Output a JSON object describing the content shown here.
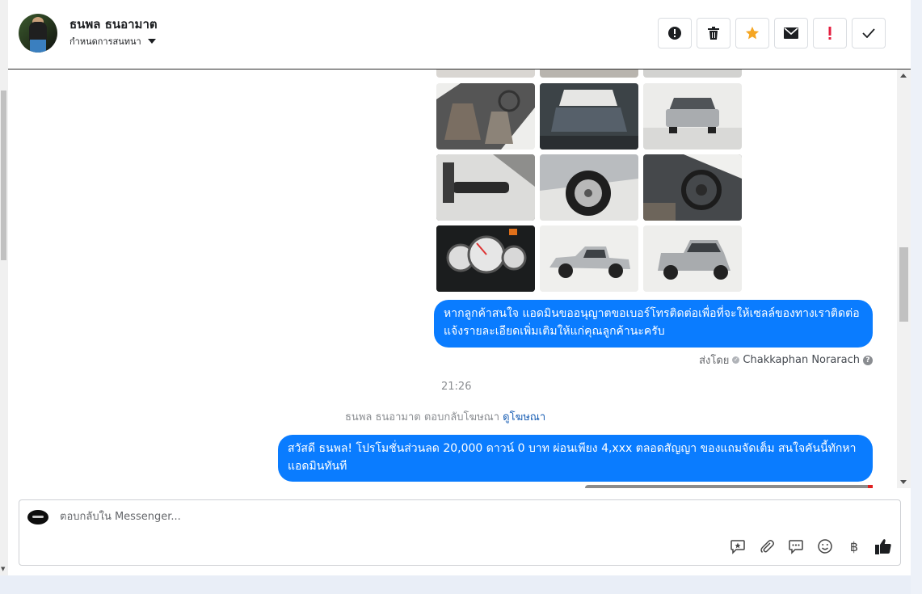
{
  "header": {
    "contact_name": "ธนพล ธนอามาต",
    "status_label": "กำหนดการสนทนา",
    "actions": [
      {
        "name": "alert-icon",
        "color": "#1c1e21"
      },
      {
        "name": "trash-icon",
        "color": "#1c1e21"
      },
      {
        "name": "star-icon",
        "color": "#f5a623"
      },
      {
        "name": "mail-icon",
        "color": "#1c1e21"
      },
      {
        "name": "exclamation-icon",
        "color": "#e41e3f"
      },
      {
        "name": "check-icon",
        "color": "#1c1e21"
      }
    ]
  },
  "conversation": {
    "photos": [
      "car-interior-front-seats",
      "car-interior-rear-seat",
      "car-rear-view",
      "car-door-panel",
      "car-wheel",
      "car-steering-wheel",
      "car-gauge-cluster",
      "car-side-view",
      "car-rear-three-quarter"
    ],
    "message_1": "หากลูกค้าสนใจ แอดมินขออนุญาตขอเบอร์โทรติดต่อเพื่อที่จะให้เซลล์ของทางเราติดต่อแจ้งรายละเอียดเพิ่มเติมให้แก่คุณลูกค้านะครับ",
    "sent_by_label": "ส่งโดย",
    "sent_by_agent": "Chakkaphan Norarach",
    "timestamp": "21:26",
    "ad_reply_text": "ธนพล ธนอามาต ตอบกลับโฆษณา",
    "ad_link": "ดูโฆษณา",
    "message_2": "สวัสดี ธนพล! โปรโมชั่นส่วนลด 20,000 ดาวน์ 0 บาท ผ่อนเพียง 4,xxx ตลอดสัญญา ของแถมจัดเต็ม สนใจคันนี้ทักหาแอดมินทันที"
  },
  "composer": {
    "placeholder": "ตอบกลับใน Messenger...",
    "tools": [
      "saved-reply-icon",
      "attachment-icon",
      "chat-icon",
      "emoji-icon",
      "baht-icon",
      "thumbs-up-icon"
    ],
    "currency_symbol": "฿"
  },
  "colors": {
    "bubble": "#0a7cff",
    "link": "#1a5fb4"
  }
}
